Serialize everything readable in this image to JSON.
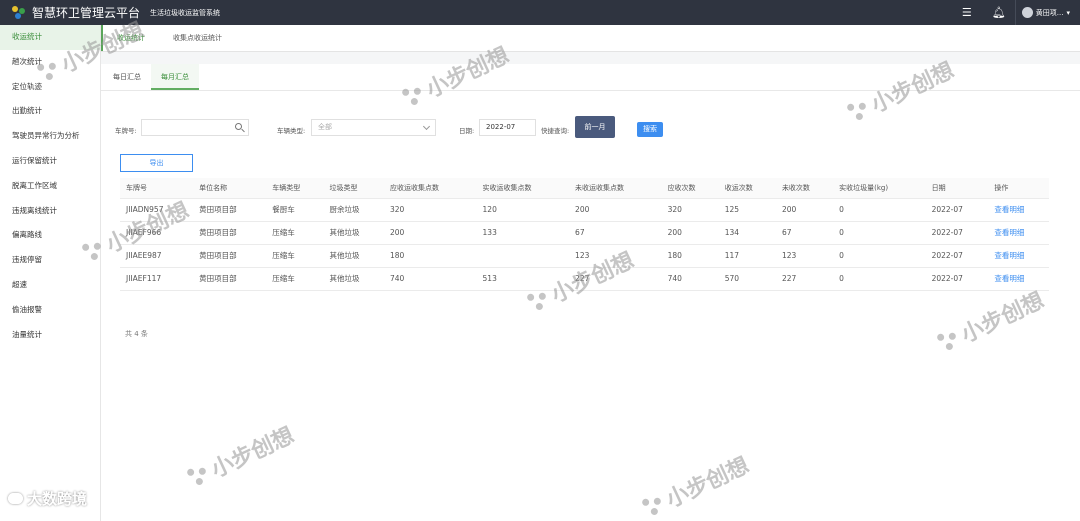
{
  "app": {
    "title": "智慧环卫管理云平台",
    "subtitle": "生活垃圾收运监管系统",
    "user_name": "黄田项...",
    "brand_colors": {
      "topbar": "#2f3440",
      "accent_green": "#3a8e3a",
      "link_blue": "#3d8ef0"
    }
  },
  "sidebar": {
    "items": [
      {
        "label": "收运统计",
        "active": true
      },
      {
        "label": "趟次统计"
      },
      {
        "label": "定位轨迹"
      },
      {
        "label": "出勤统计"
      },
      {
        "label": "驾驶员异常行为分析"
      },
      {
        "label": "运行保留统计"
      },
      {
        "label": "脱离工作区域"
      },
      {
        "label": "违规离线统计"
      },
      {
        "label": "偏离路线"
      },
      {
        "label": "违规停留"
      },
      {
        "label": "超速"
      },
      {
        "label": "偷油报警"
      },
      {
        "label": "油量统计"
      }
    ]
  },
  "page_tabs": [
    {
      "label": "收运统计",
      "active": true
    },
    {
      "label": "收集点收运统计"
    }
  ],
  "sub_tabs": [
    {
      "label": "每日汇总"
    },
    {
      "label": "每月汇总",
      "active": true
    }
  ],
  "filters": {
    "plate_label": "车牌号:",
    "plate_value": "",
    "vehicle_type_label": "车辆类型:",
    "vehicle_type_value": "全部",
    "date_label": "日期:",
    "date_value": "2022-07",
    "quick_label": "快捷查询:",
    "prev_month_label": "前一月",
    "search_label": "搜索"
  },
  "export_label": "导出",
  "table": {
    "headers": [
      "车牌号",
      "单位名称",
      "车辆类型",
      "垃圾类型",
      "应收运收集点数",
      "实收运收集点数",
      "未收运收集点数",
      "应收次数",
      "收运次数",
      "未收次数",
      "实收垃圾量(kg)",
      "日期",
      "操作"
    ],
    "rows": [
      [
        "JIIADN957",
        "黄田项目部",
        "餐厨车",
        "厨余垃圾",
        "320",
        "120",
        "200",
        "320",
        "125",
        "200",
        "0",
        "2022-07",
        "查看明细"
      ],
      [
        "JIIAEF966",
        "黄田项目部",
        "压缩车",
        "其他垃圾",
        "200",
        "133",
        "67",
        "200",
        "134",
        "67",
        "0",
        "2022-07",
        "查看明细"
      ],
      [
        "JIIAEE987",
        "黄田项目部",
        "压缩车",
        "其他垃圾",
        "180",
        "",
        "123",
        "180",
        "117",
        "123",
        "0",
        "2022-07",
        "查看明细"
      ],
      [
        "JIIAEF117",
        "黄田项目部",
        "压缩车",
        "其他垃圾",
        "740",
        "513",
        "227",
        "740",
        "570",
        "227",
        "0",
        "2022-07",
        "查看明细"
      ]
    ]
  },
  "total_text": "共 4 条",
  "watermark_text": "小步创想",
  "footer_brand": "大数跨境"
}
